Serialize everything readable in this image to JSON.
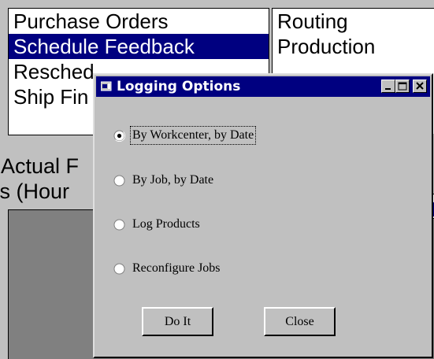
{
  "background_lists": {
    "left_items": [
      {
        "label": "Purchase Orders",
        "selected": false
      },
      {
        "label": "Schedule Feedback",
        "selected": true
      },
      {
        "label": "Resched",
        "selected": false
      },
      {
        "label": "Ship Fin",
        "selected": false
      }
    ],
    "right_items": [
      {
        "label": "Routing",
        "selected": false
      },
      {
        "label": "Production",
        "selected": false
      }
    ],
    "left_panel_lines": [
      "r Actual F",
      "lts (Hour"
    ]
  },
  "dialog": {
    "title": "Logging Options",
    "title_icon": "app-window-icon",
    "options": [
      {
        "label": "By Workcenter, by Date",
        "selected": true
      },
      {
        "label": "By Job, by Date",
        "selected": false
      },
      {
        "label": "Log Products",
        "selected": false
      },
      {
        "label": "Reconfigure Jobs",
        "selected": false
      }
    ],
    "buttons": {
      "do_it": "Do It",
      "close": "Close"
    }
  },
  "colors": {
    "selection": "#000080",
    "face": "#c0c0c0",
    "titlebar": "#000080"
  }
}
